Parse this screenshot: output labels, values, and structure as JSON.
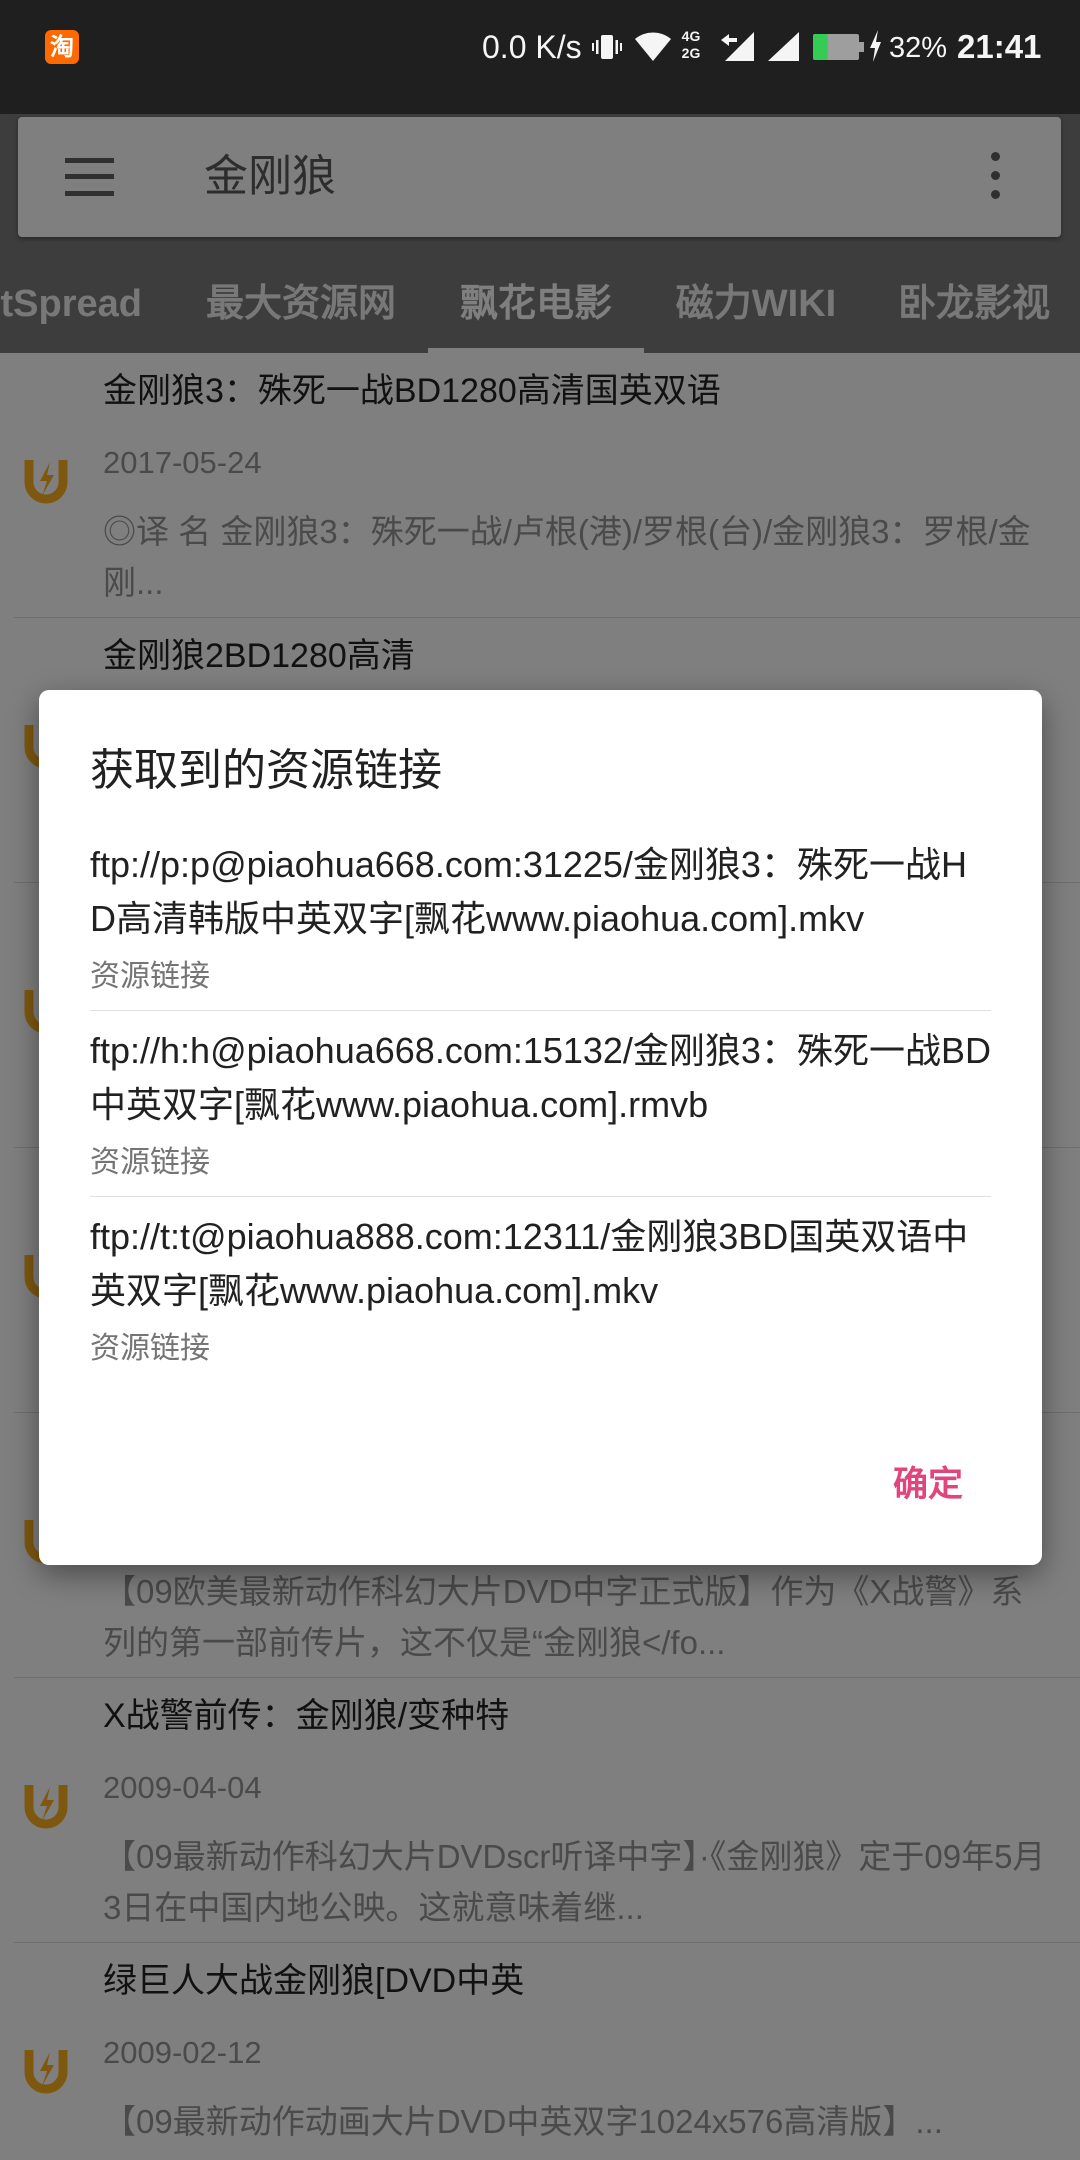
{
  "status_bar": {
    "notification_icon": "taobao-icon",
    "notification_icon_text": "淘",
    "network_speed": "0.0 K/s",
    "network_type_top": "4G",
    "network_type_bottom": "2G",
    "battery_level": 0.32,
    "battery_percent": "32%",
    "charging": true,
    "time": "21:41",
    "icons": [
      "vibrate-icon",
      "wifi-icon",
      "signal-icon",
      "signal-icon",
      "battery-icon",
      "charging-bolt-icon"
    ]
  },
  "search_bar": {
    "menu_icon": "hamburger-menu-icon",
    "query": "金刚狼",
    "overflow_icon": "more-vert-icon"
  },
  "tabs": [
    {
      "label": "BtSpread",
      "active": false
    },
    {
      "label": "最大资源网",
      "active": false
    },
    {
      "label": "飘花电影",
      "active": true
    },
    {
      "label": "磁力WIKI",
      "active": false
    },
    {
      "label": "卧龙影视",
      "active": false
    }
  ],
  "results": [
    {
      "icon": "magnet-icon",
      "title": "金刚狼3：殊死一战BD1280高清国英双语",
      "date": "2017-05-24",
      "summary": "◎译 名 金刚狼3：殊死一战/卢根(港)/罗根(台)/金刚狼3：罗根/金刚..."
    },
    {
      "icon": "magnet-icon",
      "title": "金刚狼2BD1280高清"
    },
    {
      "icon": "magnet-icon"
    },
    {
      "icon": "magnet-icon"
    },
    {
      "icon": "magnet-icon",
      "summary": "【09欧美最新动作科幻大片DVD中字正式版】作为《X战警》系列的第一部前传片，这不仅是“金刚狼</fo..."
    },
    {
      "icon": "magnet-icon",
      "title": "X战警前传：金刚狼/变种特",
      "date": "2009-04-04",
      "summary": "【09最新动作科幻大片DVDscr听译中字】·《金刚狼》定于09年5月3日在中国内地公映。这就意味着继..."
    },
    {
      "icon": "magnet-icon",
      "title": "绿巨人大战金刚狼[DVD中英",
      "date": "2009-02-12",
      "summary": "【09最新动作动画大片DVD中英双字1024x576高清版】..."
    }
  ],
  "dialog": {
    "title": "获取到的资源链接",
    "links": [
      {
        "url": "ftp://p:p@piaohua668.com:31225/金刚狼3：殊死一战HD高清韩版中英双字[飘花www.piaohua.com].mkv",
        "caption": "资源链接"
      },
      {
        "url": "ftp://h:h@piaohua668.com:15132/金刚狼3：殊死一战BD中英双字[飘花www.piaohua.com].rmvb",
        "caption": "资源链接"
      },
      {
        "url": "ftp://t:t@piaohua888.com:12311/金刚狼3BD国英双语中英双字[飘花www.piaohua.com].mkv",
        "caption": "资源链接"
      }
    ],
    "confirm_label": "确定"
  },
  "colors": {
    "accent": "#e0467c",
    "magnet_icon": "#ffb020",
    "battery_fill": "#33cc55",
    "status_bar": "#1f1f1f"
  }
}
